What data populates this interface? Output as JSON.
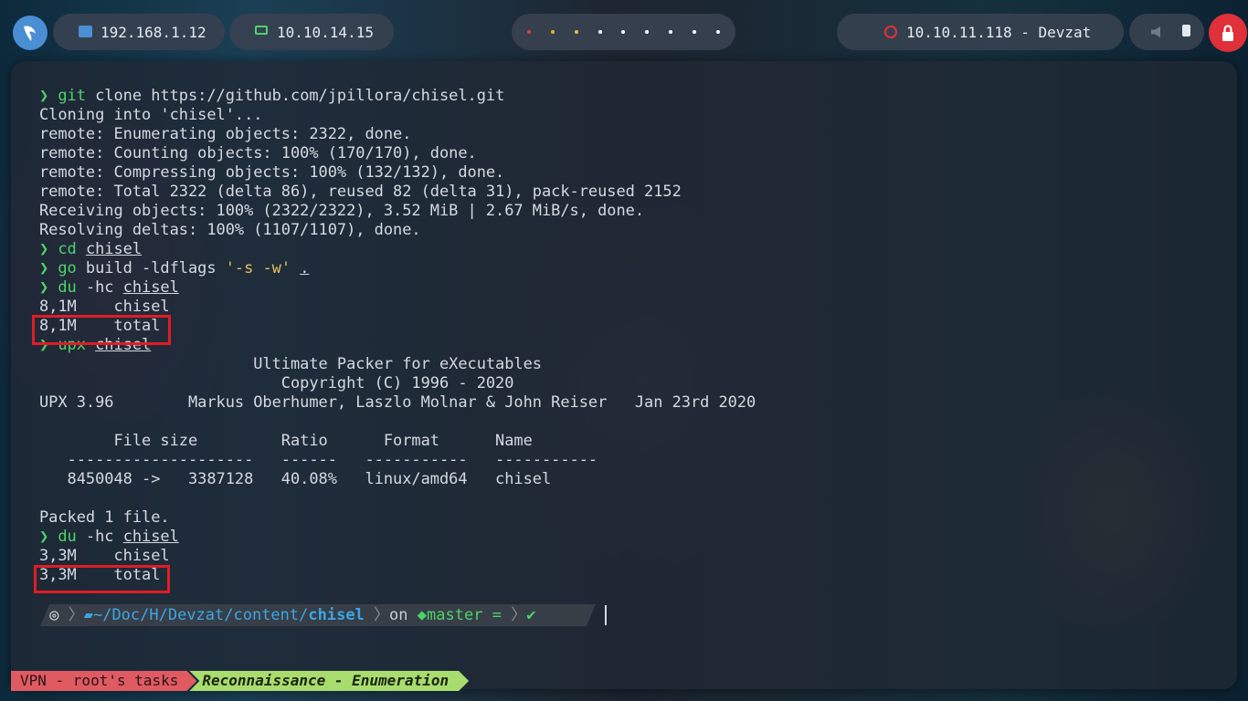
{
  "topbar": {
    "ip_local": "192.168.1.12",
    "ip_vpn": "10.10.14.15",
    "target": "10.10.11.118 - Devzat",
    "workspace_dot_colors": [
      "#e04040",
      "#f0b020",
      "#f0c040",
      "#ffffff",
      "#ffffff",
      "#ffffff",
      "#ffffff",
      "#ffffff",
      "#ffffff"
    ]
  },
  "terminal": {
    "lines": [
      {
        "prompt": "❯",
        "cmd": "git",
        "rest": " clone https://github.com/jpillora/chisel.git"
      },
      {
        "text": "Cloning into 'chisel'..."
      },
      {
        "text": "remote: Enumerating objects: 2322, done."
      },
      {
        "text": "remote: Counting objects: 100% (170/170), done."
      },
      {
        "text": "remote: Compressing objects: 100% (132/132), done."
      },
      {
        "text": "remote: Total 2322 (delta 86), reused 82 (delta 31), pack-reused 2152"
      },
      {
        "text": "Receiving objects: 100% (2322/2322), 3.52 MiB | 2.67 MiB/s, done."
      },
      {
        "text": "Resolving deltas: 100% (1107/1107), done."
      },
      {
        "prompt": "❯",
        "cmd": "cd",
        "arg": "chisel"
      },
      {
        "prompt": "❯",
        "cmd": "go",
        "rest": " build -ldflags ",
        "quoted": "'-s -w'",
        "arg": "."
      },
      {
        "prompt": "❯",
        "cmd": "du",
        "rest": " -hc ",
        "arg": "chisel"
      },
      {
        "text": "8,1M    chisel"
      },
      {
        "text": "8,1M    total"
      },
      {
        "prompt": "❯",
        "cmd": "upx",
        "arg": "chisel"
      },
      {
        "text": "                       Ultimate Packer for eXecutables"
      },
      {
        "text": "                          Copyright (C) 1996 - 2020"
      },
      {
        "text": "UPX 3.96        Markus Oberhumer, Laszlo Molnar & John Reiser   Jan 23rd 2020"
      },
      {
        "text": ""
      },
      {
        "text": "        File size         Ratio      Format      Name"
      },
      {
        "text": "   --------------------   ------   -----------   -----------"
      },
      {
        "text": "   8450048 ->   3387128   40.08%   linux/amd64   chisel"
      },
      {
        "text": ""
      },
      {
        "text": "Packed 1 file."
      },
      {
        "prompt": "❯",
        "cmd": "du",
        "rest": " -hc ",
        "arg": "chisel"
      },
      {
        "text": "3,3M    chisel"
      },
      {
        "text": "3,3M    total"
      }
    ]
  },
  "prompt_bar": {
    "path_prefix": "~/Doc/H/Devzat/content/",
    "path_dir": "chisel",
    "on": "on",
    "branch": "master",
    "status": "=",
    "check": "✔"
  },
  "tmux": {
    "session": "VPN - root's tasks",
    "window": "Reconnaissance - Enumeration"
  }
}
